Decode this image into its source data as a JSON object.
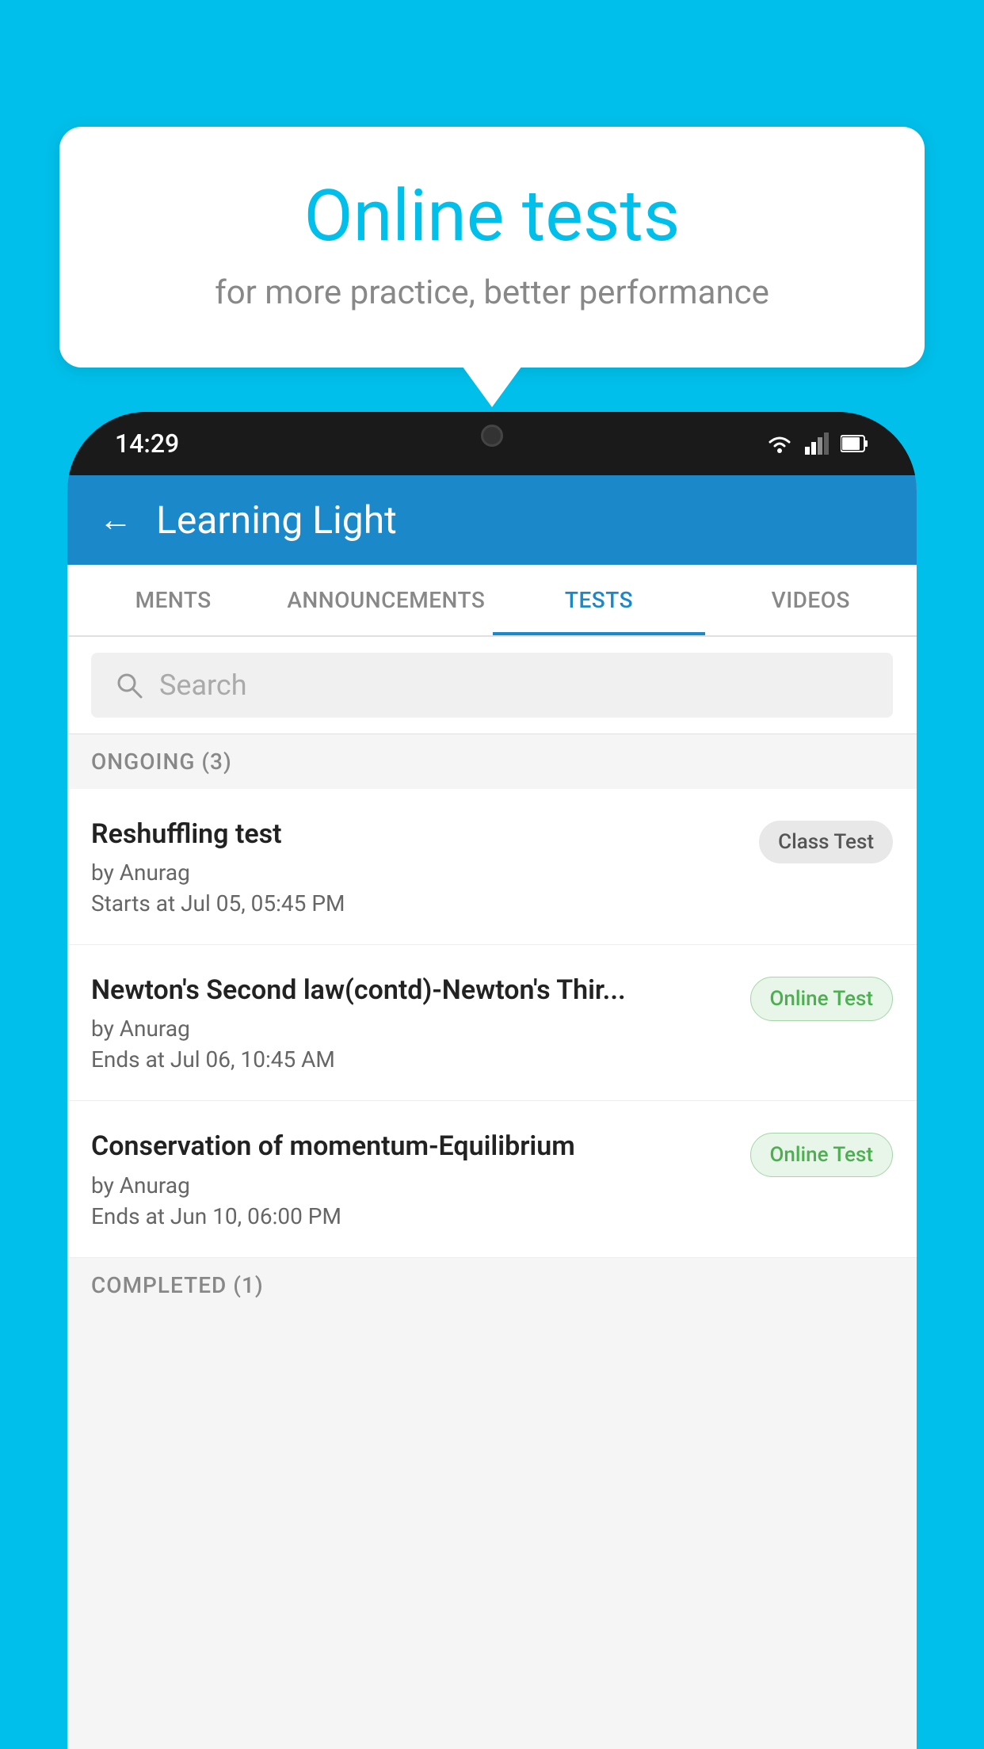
{
  "background_color": "#00BFEA",
  "bubble": {
    "title": "Online tests",
    "subtitle": "for more practice, better performance"
  },
  "phone": {
    "status_time": "14:29",
    "status_icons": [
      "wifi",
      "signal",
      "battery"
    ]
  },
  "app": {
    "back_label": "←",
    "title": "Learning Light",
    "tabs": [
      {
        "label": "MENTS",
        "active": false
      },
      {
        "label": "ANNOUNCEMENTS",
        "active": false
      },
      {
        "label": "TESTS",
        "active": true
      },
      {
        "label": "VIDEOS",
        "active": false
      }
    ],
    "search_placeholder": "Search",
    "ongoing_label": "ONGOING (3)",
    "tests": [
      {
        "name": "Reshuffling test",
        "by": "by Anurag",
        "time": "Starts at  Jul 05, 05:45 PM",
        "badge": "Class Test",
        "badge_type": "class"
      },
      {
        "name": "Newton's Second law(contd)-Newton's Thir...",
        "by": "by Anurag",
        "time": "Ends at  Jul 06, 10:45 AM",
        "badge": "Online Test",
        "badge_type": "online"
      },
      {
        "name": "Conservation of momentum-Equilibrium",
        "by": "by Anurag",
        "time": "Ends at  Jun 10, 06:00 PM",
        "badge": "Online Test",
        "badge_type": "online"
      }
    ],
    "completed_label": "COMPLETED (1)"
  }
}
